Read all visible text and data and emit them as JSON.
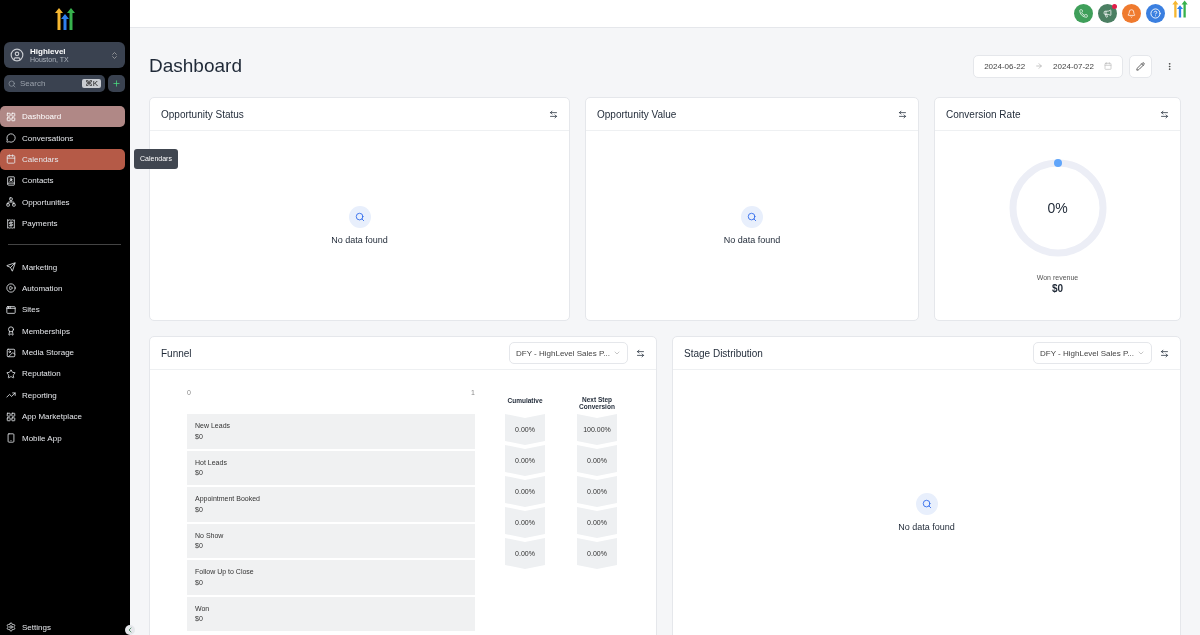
{
  "account": {
    "name": "Highlevel",
    "location": "Houston, TX"
  },
  "search": {
    "placeholder": "Search",
    "shortcut": "⌘K"
  },
  "sidebar": {
    "groups": [
      [
        {
          "label": "Dashboard",
          "selected": true,
          "highlighted": false
        },
        {
          "label": "Conversations",
          "selected": false,
          "highlighted": false
        },
        {
          "label": "Calendars",
          "selected": false,
          "highlighted": true
        },
        {
          "label": "Contacts",
          "selected": false,
          "highlighted": false
        },
        {
          "label": "Opportunities",
          "selected": false,
          "highlighted": false
        },
        {
          "label": "Payments",
          "selected": false,
          "highlighted": false
        }
      ],
      [
        {
          "label": "Marketing",
          "selected": false,
          "highlighted": false
        },
        {
          "label": "Automation",
          "selected": false,
          "highlighted": false
        },
        {
          "label": "Sites",
          "selected": false,
          "highlighted": false
        },
        {
          "label": "Memberships",
          "selected": false,
          "highlighted": false
        },
        {
          "label": "Media Storage",
          "selected": false,
          "highlighted": false
        },
        {
          "label": "Reputation",
          "selected": false,
          "highlighted": false
        },
        {
          "label": "Reporting",
          "selected": false,
          "highlighted": false
        },
        {
          "label": "App Marketplace",
          "selected": false,
          "highlighted": false
        },
        {
          "label": "Mobile App",
          "selected": false,
          "highlighted": false
        }
      ]
    ],
    "tooltip": "Calendars",
    "settings": "Settings"
  },
  "header": {
    "title": "Dashboard",
    "date_from": "2024-06-22",
    "date_to": "2024-07-22"
  },
  "cards": {
    "opportunity_status": {
      "title": "Opportunity Status",
      "empty": "No data found"
    },
    "opportunity_value": {
      "title": "Opportunity Value",
      "empty": "No data found"
    },
    "conversion_rate": {
      "title": "Conversion Rate",
      "value": "0%",
      "caption": "Won revenue",
      "amount": "$0"
    }
  },
  "funnel": {
    "title": "Funnel",
    "pipeline": "DFY - HighLevel Sales P...",
    "tick_start": "0",
    "tick_end": "1",
    "col_cumulative": "Cumulative",
    "col_next": "Next Step Conversion",
    "stages": [
      {
        "name": "New Leads",
        "value": "$0",
        "cumulative": "0.00%",
        "next": "100.00%"
      },
      {
        "name": "Hot Leads",
        "value": "$0",
        "cumulative": "0.00%",
        "next": "0.00%"
      },
      {
        "name": "Appointment Booked",
        "value": "$0",
        "cumulative": "0.00%",
        "next": "0.00%"
      },
      {
        "name": "No Show",
        "value": "$0",
        "cumulative": "0.00%",
        "next": "0.00%"
      },
      {
        "name": "Follow Up to Close",
        "value": "$0",
        "cumulative": "0.00%",
        "next": "0.00%"
      },
      {
        "name": "Won",
        "value": "$0"
      }
    ]
  },
  "stage_distribution": {
    "title": "Stage Distribution",
    "pipeline": "DFY - HighLevel Sales P...",
    "empty": "No data found"
  }
}
